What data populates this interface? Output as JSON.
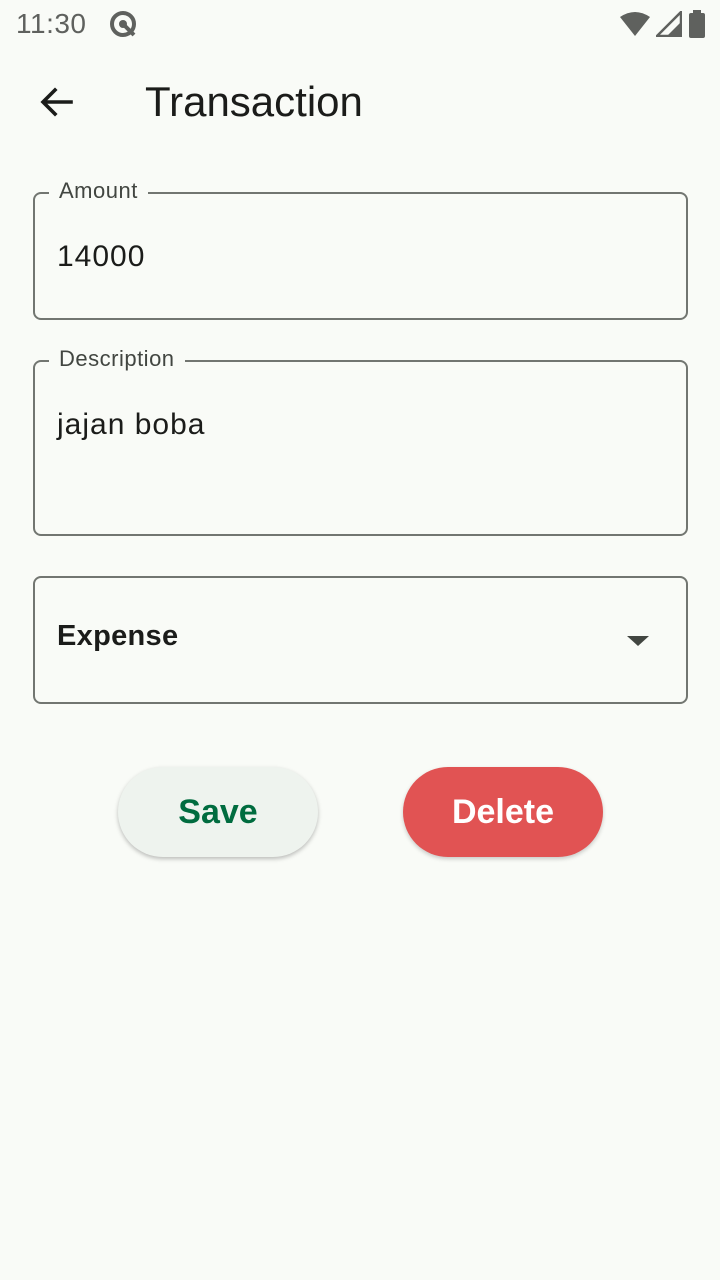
{
  "status_bar": {
    "time": "11:30",
    "icons": [
      "app-notification-icon",
      "wifi-icon",
      "signal-icon",
      "battery-icon"
    ]
  },
  "app_bar": {
    "title": "Transaction",
    "back_icon": "arrow-back-icon"
  },
  "form": {
    "amount": {
      "label": "Amount",
      "value": "14000"
    },
    "description": {
      "label": "Description",
      "value": "jajan boba"
    },
    "type": {
      "selected": "Expense",
      "icon": "dropdown-arrow-icon"
    }
  },
  "actions": {
    "save_label": "Save",
    "delete_label": "Delete"
  },
  "colors": {
    "background": "#f9fbf7",
    "save_text": "#006c3f",
    "save_bg": "#eef3ee",
    "delete_bg": "#e15353",
    "outline": "#727671"
  }
}
